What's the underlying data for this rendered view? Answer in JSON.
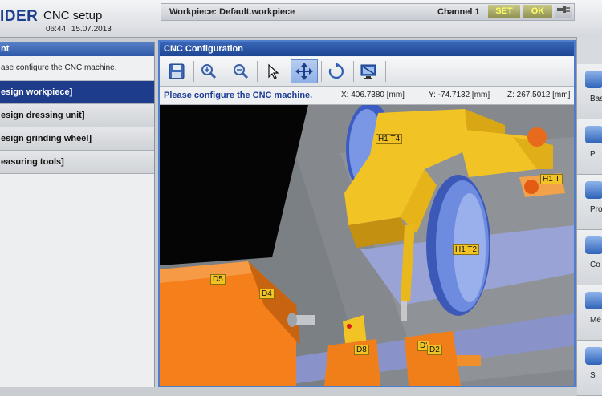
{
  "header": {
    "logo": "IDER",
    "app_title": "CNC setup",
    "time": "06:44",
    "date": "15.07.2013",
    "workpiece": "Workpiece: Default.workpiece",
    "channel": "Channel 1",
    "set_label": "SET",
    "ok_label": "OK"
  },
  "left_panel": {
    "title": "nt",
    "info": "ase configure the CNC machine.",
    "items": [
      {
        "label": "esign workpiece]",
        "selected": true
      },
      {
        "label": "esign dressing unit]",
        "selected": false
      },
      {
        "label": "esign grinding wheel]",
        "selected": false
      },
      {
        "label": "easuring tools]",
        "selected": false
      }
    ]
  },
  "main_window": {
    "title": "CNC Configuration",
    "toolbar": [
      {
        "icon": "save-icon"
      },
      {
        "icon": "zoom-in-icon"
      },
      {
        "icon": "zoom-out-icon"
      },
      {
        "icon": "pointer-icon"
      },
      {
        "icon": "move-icon",
        "active": true
      },
      {
        "icon": "rotate-icon"
      },
      {
        "icon": "monitor-icon"
      }
    ],
    "status_message": "Please configure the CNC machine.",
    "x": "X: 406.7380 [mm]",
    "y": "Y: -74.7132 [mm]",
    "z": "Z: 267.5012 [mm]",
    "labels": {
      "h1t4": "H1 T4",
      "h1t2": "H1 T2",
      "h1t1": "H1 T",
      "d5": "D5",
      "d4": "D4",
      "d8": "D8",
      "d2": "D2",
      "d_prime": "D'"
    }
  },
  "right_strip": {
    "items": [
      "Bas",
      "P",
      "Prog",
      "Co",
      "Me",
      "S"
    ]
  },
  "colors": {
    "accent_blue": "#1e3c8c",
    "machine_yellow": "#f2c324",
    "machine_orange": "#f07f1a",
    "wheel_blue": "#5f7fd6"
  }
}
